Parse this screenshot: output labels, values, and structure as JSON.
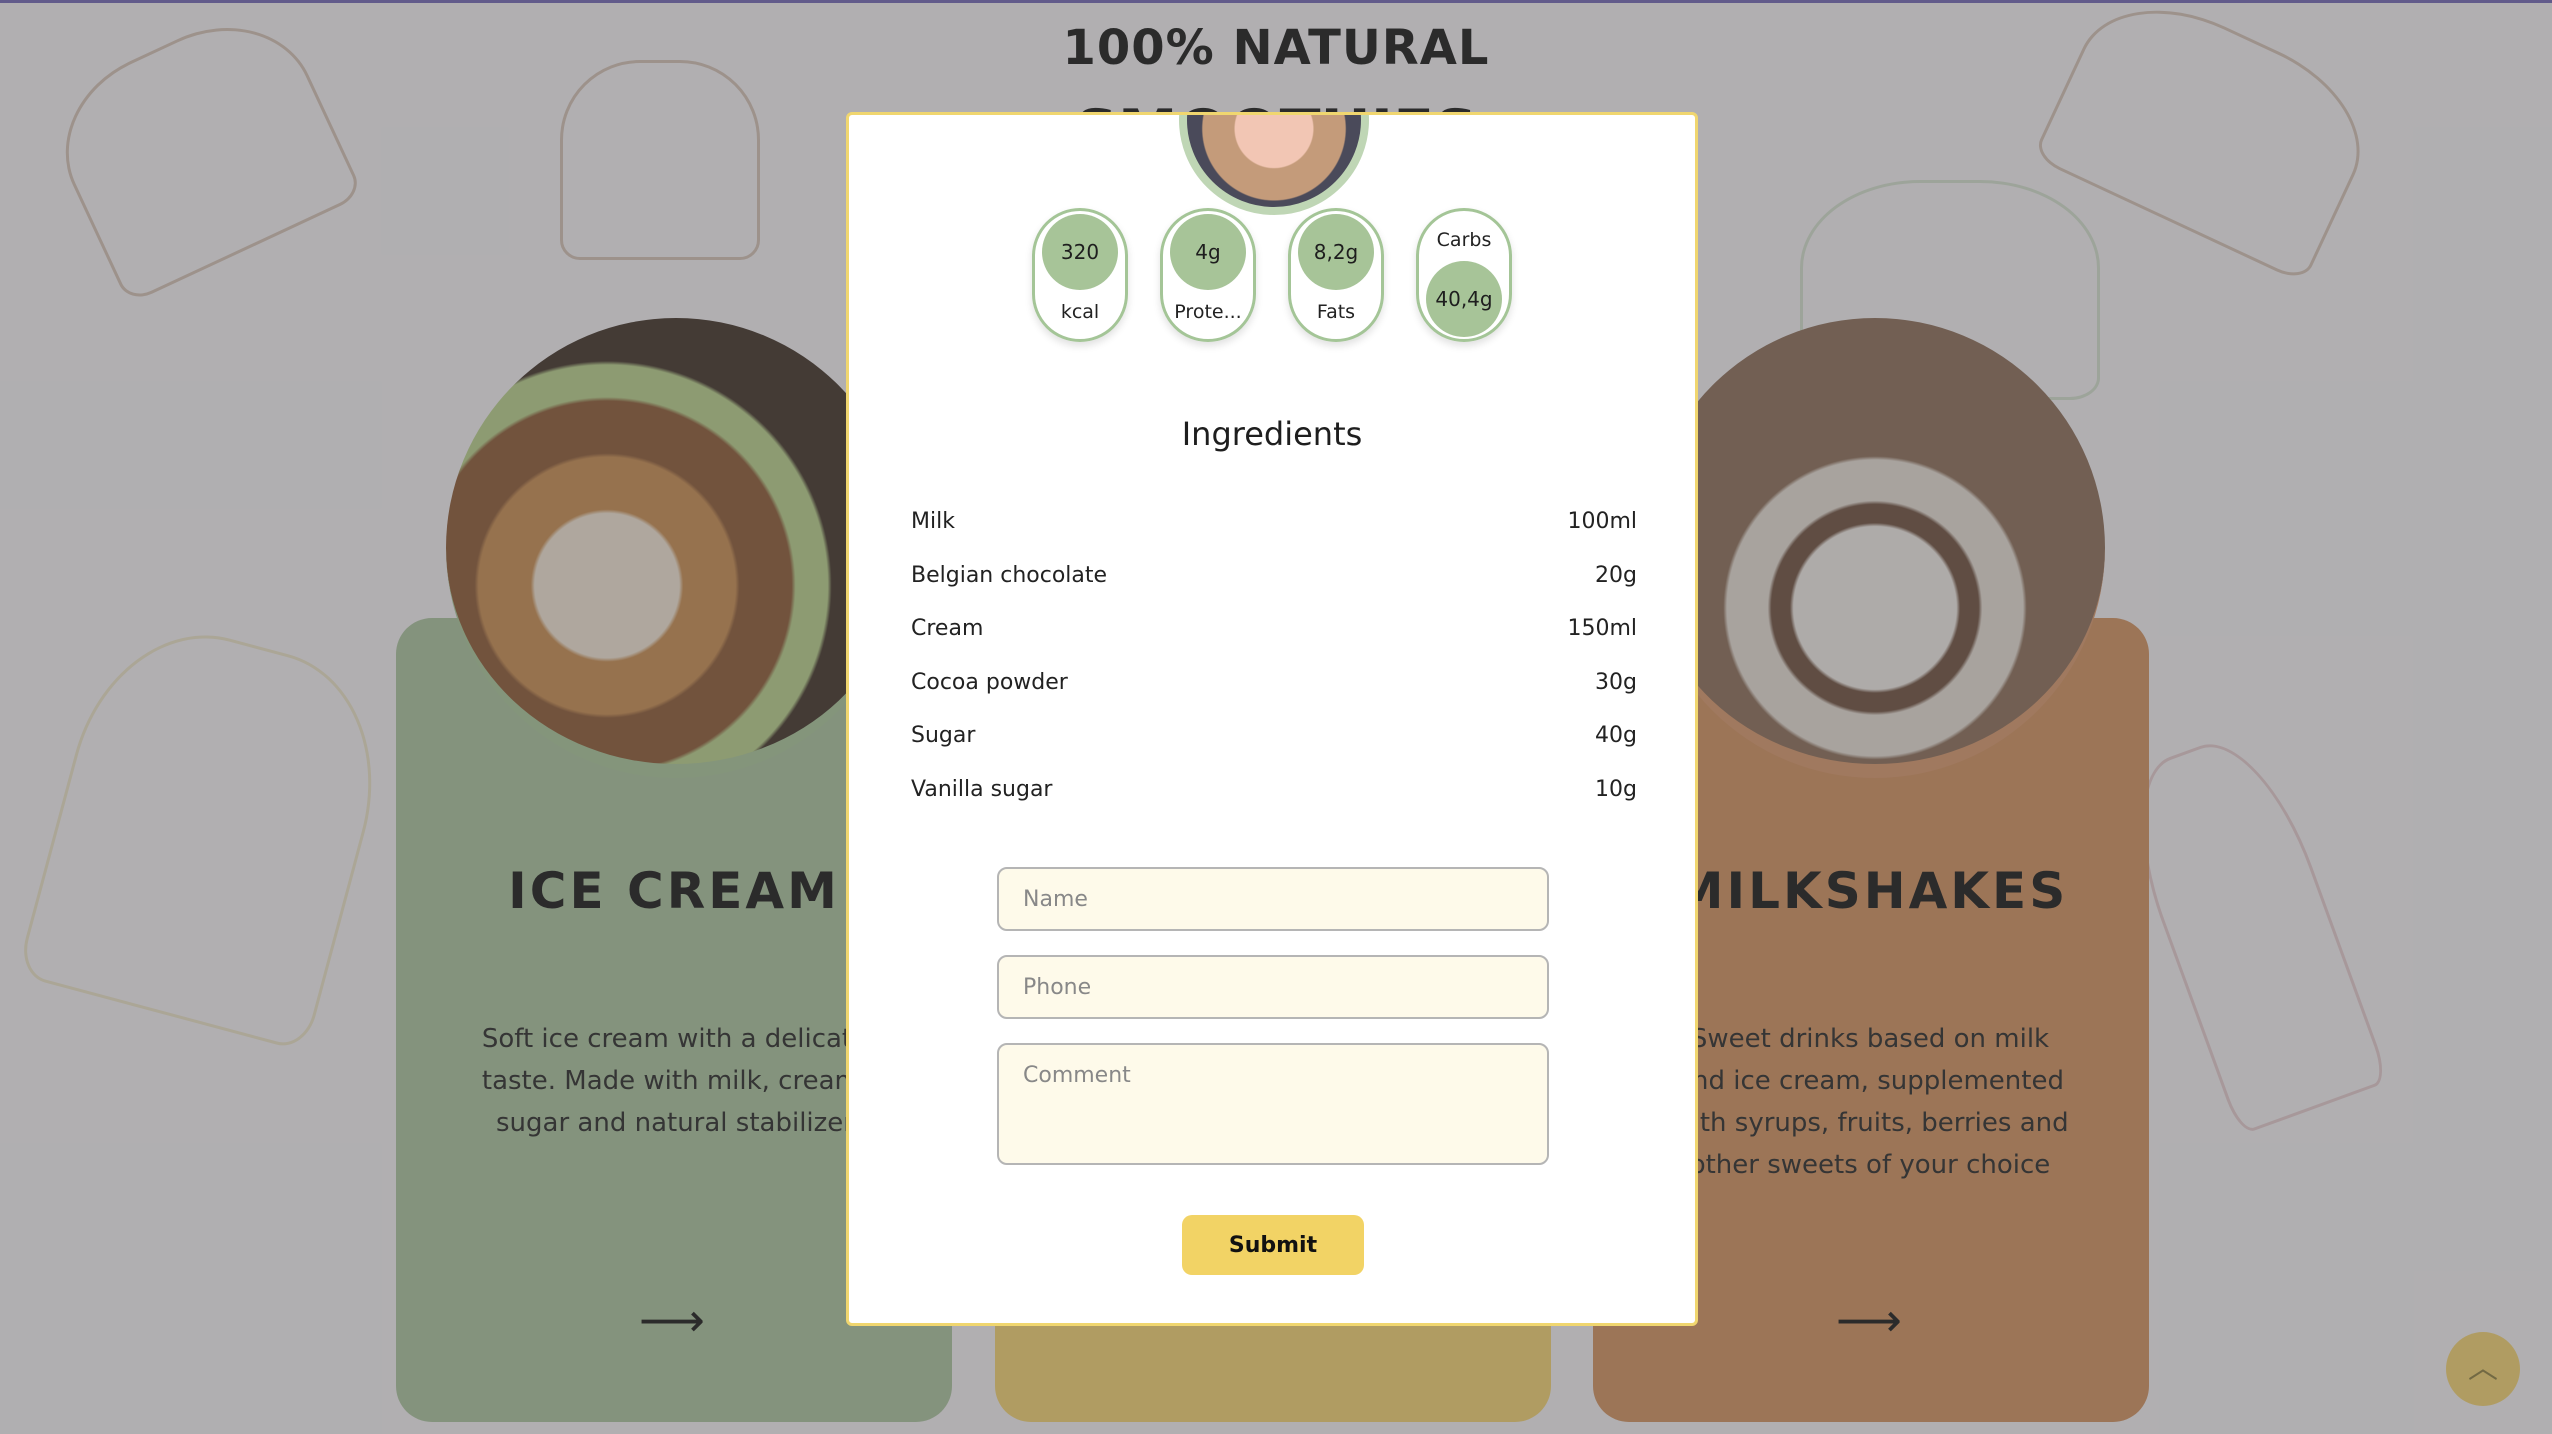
{
  "header": {
    "headline": "100% NATURAL",
    "headline_partial": "SMOOTHIES"
  },
  "cards": [
    {
      "title": "ICE CREAM",
      "description": "Soft ice cream with a delicate taste. Made with milk, cream, sugar and natural stabilizer",
      "arrow": "⟶",
      "color": "#aac39d"
    },
    {
      "title": "",
      "description": "",
      "arrow": "",
      "color": "#f4d36f"
    },
    {
      "title": "MILKSHAKES",
      "description": "Sweet drinks based on milk and ice cream, supplemented with syrups, fruits, berries and other sweets of your choice",
      "arrow": "⟶",
      "color": "#d38f5c"
    }
  ],
  "modal": {
    "nutrients": [
      {
        "value": "320",
        "label": "kcal"
      },
      {
        "value": "4g",
        "label": "Prote..."
      },
      {
        "value": "8,2g",
        "label": "Fats"
      },
      {
        "value": "40,4g",
        "label": "Carbs"
      }
    ],
    "ingredients_title": "Ingredients",
    "ingredients": [
      {
        "name": "Milk",
        "amount": "100ml"
      },
      {
        "name": "Belgian chocolate",
        "amount": "20g"
      },
      {
        "name": "Cream",
        "amount": "150ml"
      },
      {
        "name": "Cocoa powder",
        "amount": "30g"
      },
      {
        "name": "Sugar",
        "amount": "40g"
      },
      {
        "name": "Vanilla sugar",
        "amount": "10g"
      }
    ],
    "form": {
      "name_placeholder": "Name",
      "phone_placeholder": "Phone",
      "comment_placeholder": "Comment",
      "submit_label": "Submit"
    }
  },
  "scroll_top": {
    "icon": "chevron-up-icon",
    "glyph": "︿"
  },
  "colors": {
    "accent_yellow": "#f2d365",
    "nutrient_green": "#a7c498",
    "modal_border": "#f0d66f"
  }
}
